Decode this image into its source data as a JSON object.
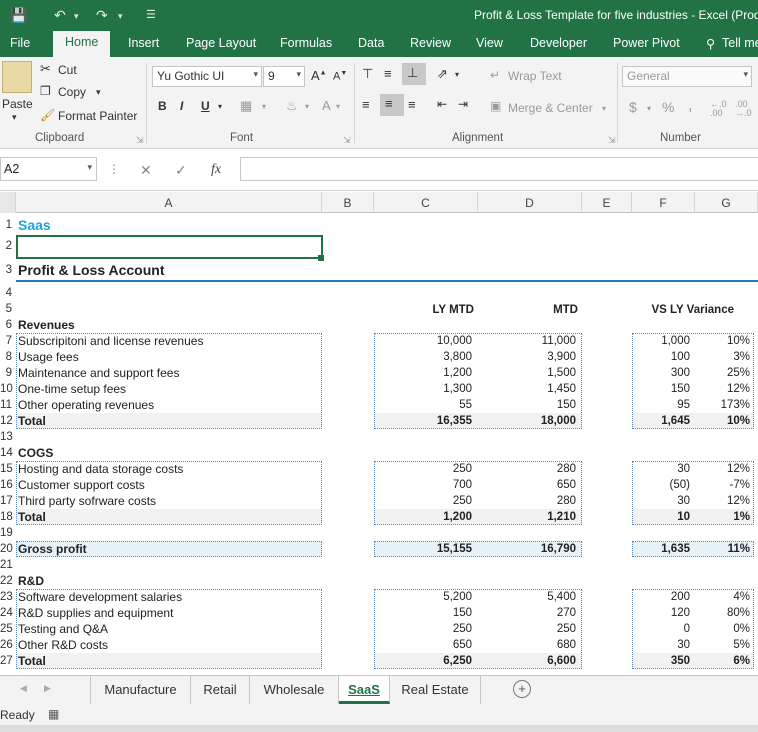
{
  "window": {
    "title": "Profit & Loss Template for five industries - Excel (Prod",
    "qat_icons": [
      "save-icon",
      "undo-icon",
      "redo-icon",
      "customize-qat-icon"
    ]
  },
  "ribbon_tabs": [
    "File",
    "Home",
    "Insert",
    "Page Layout",
    "Formulas",
    "Data",
    "Review",
    "View",
    "Developer",
    "Power Pivot",
    "Tell me"
  ],
  "ribbon": {
    "clipboard": {
      "paste": "Paste",
      "cut": "Cut",
      "copy": "Copy",
      "format_painter": "Format Painter",
      "label": "Clipboard"
    },
    "font": {
      "name": "Yu Gothic UI",
      "size": "9",
      "bold": "B",
      "italic": "I",
      "underline": "U",
      "label": "Font"
    },
    "alignment": {
      "wrap_text": "Wrap Text",
      "merge_center": "Merge & Center",
      "label": "Alignment"
    },
    "number": {
      "format": "General",
      "currency": "$",
      "percent": "%",
      "comma": ",",
      "label": "Number"
    }
  },
  "formula_bar": {
    "name_box": "A2",
    "fx": "fx",
    "value": ""
  },
  "columns": [
    "A",
    "B",
    "C",
    "D",
    "E",
    "F",
    "G"
  ],
  "sheet": {
    "title": "Saas",
    "subtitle": "Profit & Loss Account",
    "headers": {
      "ly_mtd": "LY MTD",
      "mtd": "MTD",
      "variance": "VS LY Variance"
    },
    "rows": [
      {
        "n": "1",
        "a": ""
      },
      {
        "n": "2",
        "a": ""
      },
      {
        "n": "3",
        "a": ""
      },
      {
        "n": "4",
        "a": ""
      },
      {
        "n": "5",
        "a": ""
      },
      {
        "n": "6",
        "a": "Revenues",
        "bold": true
      },
      {
        "n": "7",
        "a": "Subscripitoni and license revenues",
        "c": "10,000",
        "d": "11,000",
        "f": "1,000",
        "g": "10%"
      },
      {
        "n": "8",
        "a": "Usage fees",
        "c": "3,800",
        "d": "3,900",
        "f": "100",
        "g": "3%"
      },
      {
        "n": "9",
        "a": "Maintenance and support fees",
        "c": "1,200",
        "d": "1,500",
        "f": "300",
        "g": "25%"
      },
      {
        "n": "10",
        "a": "One-time setup fees",
        "c": "1,300",
        "d": "1,450",
        "f": "150",
        "g": "12%"
      },
      {
        "n": "11",
        "a": "Other operating revenues",
        "c": "55",
        "d": "150",
        "f": "95",
        "g": "173%"
      },
      {
        "n": "12",
        "a": "Total",
        "c": "16,355",
        "d": "18,000",
        "f": "1,645",
        "g": "10%",
        "bold": true,
        "total": true
      },
      {
        "n": "13",
        "a": ""
      },
      {
        "n": "14",
        "a": "COGS",
        "bold": true
      },
      {
        "n": "15",
        "a": "Hosting and data storage costs",
        "c": "250",
        "d": "280",
        "f": "30",
        "g": "12%"
      },
      {
        "n": "16",
        "a": "Customer support costs",
        "c": "700",
        "d": "650",
        "f": "(50)",
        "g": "-7%"
      },
      {
        "n": "17",
        "a": "Third party sofrware costs",
        "c": "250",
        "d": "280",
        "f": "30",
        "g": "12%"
      },
      {
        "n": "18",
        "a": "Total",
        "c": "1,200",
        "d": "1,210",
        "f": "10",
        "g": "1%",
        "bold": true,
        "total": true
      },
      {
        "n": "19",
        "a": ""
      },
      {
        "n": "20",
        "a": "Gross profit",
        "c": "15,155",
        "d": "16,790",
        "f": "1,635",
        "g": "11%",
        "bold": true,
        "gross": true
      },
      {
        "n": "21",
        "a": ""
      },
      {
        "n": "22",
        "a": "R&D",
        "bold": true
      },
      {
        "n": "23",
        "a": "Software development salaries",
        "c": "5,200",
        "d": "5,400",
        "f": "200",
        "g": "4%"
      },
      {
        "n": "24",
        "a": "R&D supplies and equipment",
        "c": "150",
        "d": "270",
        "f": "120",
        "g": "80%"
      },
      {
        "n": "25",
        "a": "Testing and Q&A",
        "c": "250",
        "d": "250",
        "f": "0",
        "g": "0%"
      },
      {
        "n": "26",
        "a": "Other R&D costs",
        "c": "650",
        "d": "680",
        "f": "30",
        "g": "5%"
      },
      {
        "n": "27",
        "a": "Total",
        "c": "6,250",
        "d": "6,600",
        "f": "350",
        "g": "6%",
        "bold": true,
        "total": true
      }
    ]
  },
  "sheet_tabs": [
    "Manufacture",
    "Retail",
    "Wholesale",
    "SaaS",
    "Real Estate"
  ],
  "active_sheet": "SaaS",
  "status": {
    "text": "Ready"
  },
  "colors": {
    "excel_green": "#217346",
    "title_blue": "#1fa3d8",
    "accent_line": "#2e75b6"
  }
}
